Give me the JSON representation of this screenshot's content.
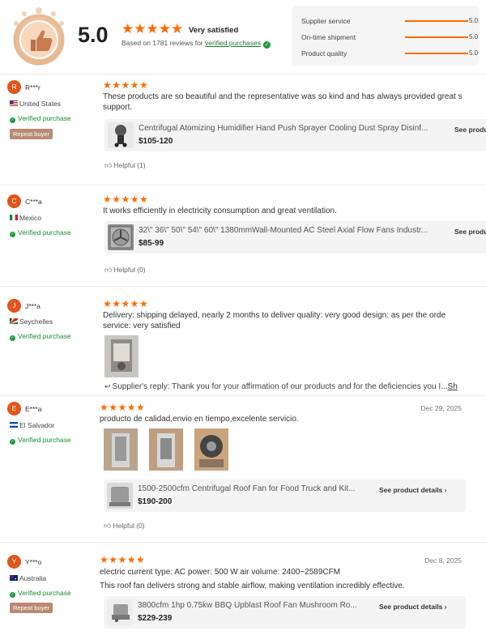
{
  "summary": {
    "score": "5.0",
    "stars": "★★★★★",
    "label": "Very satisfied",
    "based_on_prefix": "Based on 1781 reviews for",
    "verified_link": "verified purchases",
    "metrics": [
      {
        "label": "Supplier service",
        "value": "5.0",
        "fill": 1.0
      },
      {
        "label": "On-time shipment",
        "value": "5.0",
        "fill": 1.0
      },
      {
        "label": "Product quality",
        "value": "5.0",
        "fill": 1.0
      }
    ]
  },
  "reviews": [
    {
      "initial": "R",
      "name": "R***r",
      "country": "United States",
      "verified": "Verified purchase",
      "repeat": "Repeat buyer",
      "stars": "★★★★★",
      "date": "",
      "text": [
        "These products are so beautiful and the representative was so kind and has always provided great s",
        "support."
      ],
      "product": {
        "title": "Centrifugal Atomizing Humidifier Hand Push Sprayer Cooling Dust Spray Disinf...",
        "price": "$105-120",
        "details": "See product"
      },
      "helpful": "Helpful (1)"
    },
    {
      "initial": "C",
      "name": "C***a",
      "country": "Mexico",
      "verified": "Verified purchase",
      "stars": "★★★★★",
      "date": "",
      "text": [
        "It works efficiently in electricity consumption and great ventilation."
      ],
      "product": {
        "title": "32\\\" 36\\\" 50\\\" 54\\\" 60\\\" 1380mmWall-Mounted AC Steel Axial Flow Fans Industr...",
        "price": "$85-99",
        "details": "See produ"
      },
      "helpful": "Helpful (0)"
    },
    {
      "initial": "J",
      "name": "J***a",
      "country": "Seychelles",
      "verified": "Verified purchase",
      "stars": "★★★★★",
      "date": "",
      "text": [
        "Delivery:  shipping delayed, nearly 2 months to deliver quality:  very good design:  as per the orde",
        "service:  very satisfied"
      ],
      "reply": "Supplier's reply: Thank you for your affirmation of our products and for the deficiencies you I...",
      "reply_more": "Sh"
    },
    {
      "initial": "E",
      "name": "E***a",
      "country": "El Salvador",
      "verified": "Verified purchase",
      "stars": "★★★★★",
      "date": "Dec 29, 2025",
      "text": [
        "producto de calidad,envio en tiempo,excelente servicio."
      ],
      "product": {
        "title": "1500-2500cfm Centrifugal Roof Fan for Food Truck and Kit...",
        "price": "$190-200",
        "details": "See product details  ›"
      },
      "helpful": "Helpful (0)"
    },
    {
      "initial": "Y",
      "name": "Y***o",
      "country": "Australia",
      "verified": "Verified purchase",
      "repeat": "Repeat buyer",
      "stars": "★★★★★",
      "date": "Dec 8, 2025",
      "text": [
        "electric current type:  AC      power:  500 W      air volume:  2400~2589CFM",
        "This roof fan delivers strong and stable airflow, making ventilation incredibly effective."
      ],
      "product": {
        "title": "3800cfm 1hp 0.75kw BBQ Upblast Roof Fan Mushroom Ro...",
        "price": "$229-239",
        "details": "See product details  ›"
      }
    }
  ],
  "colors": {
    "accent": "#ff6a00",
    "verified": "#1c8a38",
    "avatar": "#e2551c",
    "repeat_badge": "#b98a74"
  },
  "icons": [
    "thumbs-up-badge-icon",
    "verified-check-icon",
    "helpful-thumb-icon",
    "reply-arrow-icon",
    "chevron-right-icon"
  ]
}
